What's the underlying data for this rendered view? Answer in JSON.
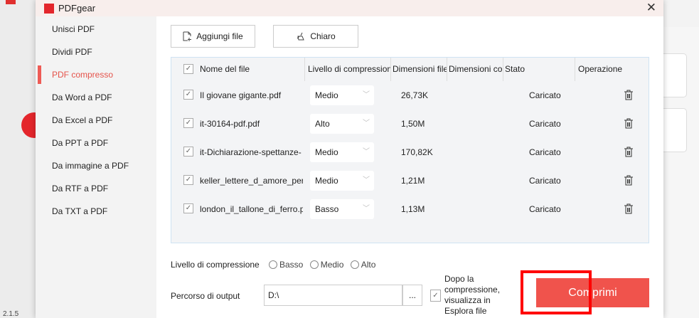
{
  "background": {
    "version": "2.1.5"
  },
  "window": {
    "title": "PDFgear",
    "close": "✕"
  },
  "sidebar": {
    "items": [
      {
        "label": "Unisci PDF"
      },
      {
        "label": "Dividi PDF"
      },
      {
        "label": "PDF compresso",
        "active": true
      },
      {
        "label": "Da Word a PDF"
      },
      {
        "label": "Da Excel a PDF"
      },
      {
        "label": "Da PPT a PDF"
      },
      {
        "label": "Da immagine a PDF"
      },
      {
        "label": "Da RTF a PDF"
      },
      {
        "label": "Da TXT a PDF"
      }
    ]
  },
  "toolbar": {
    "add_label": "Aggiungi file",
    "clear_label": "Chiaro"
  },
  "table": {
    "headers": [
      "Nome del file",
      "Livello di compressione",
      "Dimensioni file",
      "Dimensioni compresse",
      "Stato",
      "Operazione"
    ],
    "rows": [
      {
        "name": "Il giovane gigante.pdf",
        "level": "Medio",
        "size": "26,73K",
        "status": "Caricato"
      },
      {
        "name": "it-30164-pdf.pdf",
        "level": "Alto",
        "size": "1,50M",
        "status": "Caricato"
      },
      {
        "name": "it-Dichiarazione-spettanze-",
        "level": "Medio",
        "size": "170,82K",
        "status": "Caricato"
      },
      {
        "name": "keller_lettere_d_amore_perd",
        "level": "Medio",
        "size": "1,21M",
        "status": "Caricato"
      },
      {
        "name": "london_il_tallone_di_ferro.p",
        "level": "Basso",
        "size": "1,13M",
        "status": "Caricato"
      }
    ]
  },
  "compression": {
    "label": "Livello di compressione",
    "options": [
      "Basso",
      "Medio",
      "Alto"
    ]
  },
  "output": {
    "label": "Percorso di output",
    "value": "D:\\",
    "browse": "...",
    "open_after": "Dopo la compressione, visualizza in Esplora file"
  },
  "compress_button": "Comprimi",
  "colors": {
    "accent": "#f0534c",
    "highlight": "#ff0000"
  }
}
